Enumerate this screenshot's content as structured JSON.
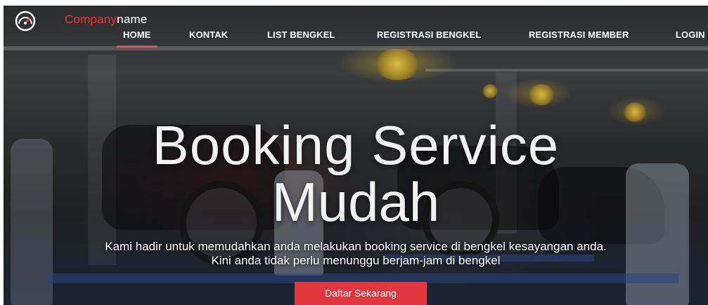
{
  "brand": {
    "name_accent": "Company",
    "name_rest": "name",
    "logo_icon": "speedometer-icon"
  },
  "nav": {
    "items": [
      {
        "label": "HOME",
        "active": true
      },
      {
        "label": "KONTAK",
        "active": false
      },
      {
        "label": "LIST BENGKEL",
        "active": false
      },
      {
        "label": "REGISTRASI BENGKEL",
        "active": false
      },
      {
        "label": "REGISTRASI MEMBER",
        "active": false
      },
      {
        "label": "LOGIN",
        "active": false
      }
    ]
  },
  "hero": {
    "title_line1": "Booking Service",
    "title_line2": "Mudah",
    "subtitle_line1": "Kami hadir untuk memudahkan anda melakukan booking service di bengkel kesayangan anda.",
    "subtitle_line2": "Kini anda tidak perlu menunggu berjam-jam di bengkel",
    "cta_label": "Daftar Sekarang"
  },
  "colors": {
    "accent": "#e8343c",
    "button": "#e33740",
    "active_underline": "#e84b52"
  }
}
